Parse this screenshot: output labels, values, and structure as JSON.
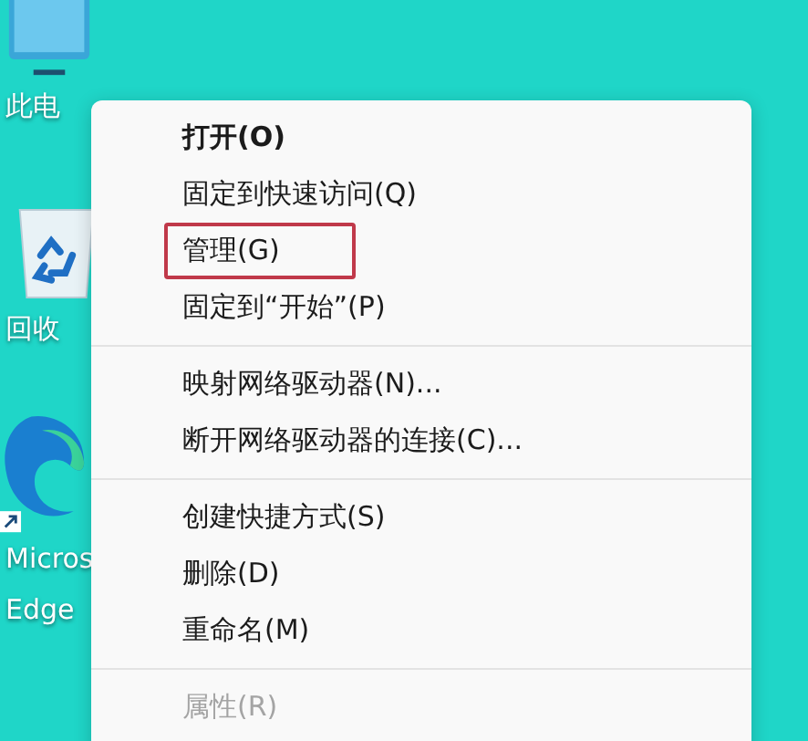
{
  "desktop_icons": [
    {
      "kind": "computer",
      "lines": [
        "此电"
      ]
    },
    {
      "kind": "recycle-bin",
      "lines": [
        "回收"
      ]
    },
    {
      "kind": "browser",
      "lines": [
        "Micros",
        "Edge"
      ]
    }
  ],
  "context_menu": {
    "items": [
      {
        "kind": "item",
        "label": "打开(O)",
        "bold": true,
        "disabled": false,
        "highlighted": false
      },
      {
        "kind": "item",
        "label": "固定到快速访问(Q)",
        "bold": false,
        "disabled": false,
        "highlighted": false
      },
      {
        "kind": "item",
        "label": "管理(G)",
        "bold": false,
        "disabled": false,
        "highlighted": true
      },
      {
        "kind": "item",
        "label": "固定到“开始”(P)",
        "bold": false,
        "disabled": false,
        "highlighted": false
      },
      {
        "kind": "separator"
      },
      {
        "kind": "item",
        "label": "映射网络驱动器(N)...",
        "bold": false,
        "disabled": false,
        "highlighted": false
      },
      {
        "kind": "item",
        "label": "断开网络驱动器的连接(C)...",
        "bold": false,
        "disabled": false,
        "highlighted": false
      },
      {
        "kind": "separator"
      },
      {
        "kind": "item",
        "label": "创建快捷方式(S)",
        "bold": false,
        "disabled": false,
        "highlighted": false
      },
      {
        "kind": "item",
        "label": "删除(D)",
        "bold": false,
        "disabled": false,
        "highlighted": false
      },
      {
        "kind": "item",
        "label": "重命名(M)",
        "bold": false,
        "disabled": false,
        "highlighted": false
      },
      {
        "kind": "separator"
      },
      {
        "kind": "item",
        "label": "属性(R)",
        "bold": false,
        "disabled": true,
        "highlighted": false
      }
    ]
  }
}
